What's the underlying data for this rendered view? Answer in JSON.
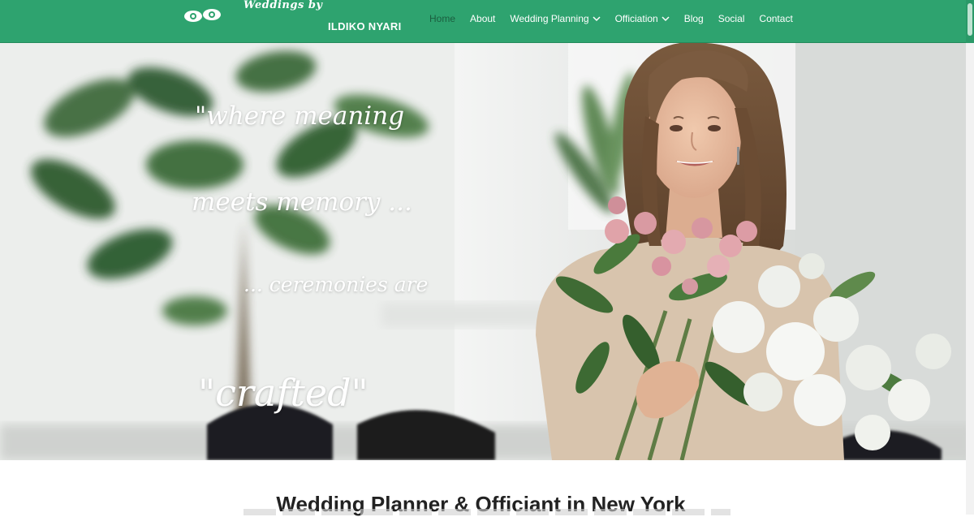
{
  "brand": {
    "script_line": "Weddings by",
    "name": "ILDIKO NYARI",
    "logo_icon": "eyes-logo-icon"
  },
  "nav": {
    "items": [
      {
        "label": "Home",
        "active": true,
        "dropdown": false
      },
      {
        "label": "About",
        "active": false,
        "dropdown": false
      },
      {
        "label": "Wedding Planning",
        "active": false,
        "dropdown": true
      },
      {
        "label": "Officiation",
        "active": false,
        "dropdown": true
      },
      {
        "label": "Blog",
        "active": false,
        "dropdown": false
      },
      {
        "label": "Social",
        "active": false,
        "dropdown": false
      },
      {
        "label": "Contact",
        "active": false,
        "dropdown": false
      }
    ]
  },
  "hero": {
    "line1": "\"where meaning",
    "line2": "meets memory ...",
    "line3": "... ceremonies are",
    "line4": "\"crafted\""
  },
  "section": {
    "headline": "Wedding Planner & Officiant in New York"
  },
  "colors": {
    "nav_bg": "#2ea36f",
    "nav_active_text": "#1b5e3f",
    "quote_text": "#ffffff",
    "headline_text": "#222222"
  }
}
